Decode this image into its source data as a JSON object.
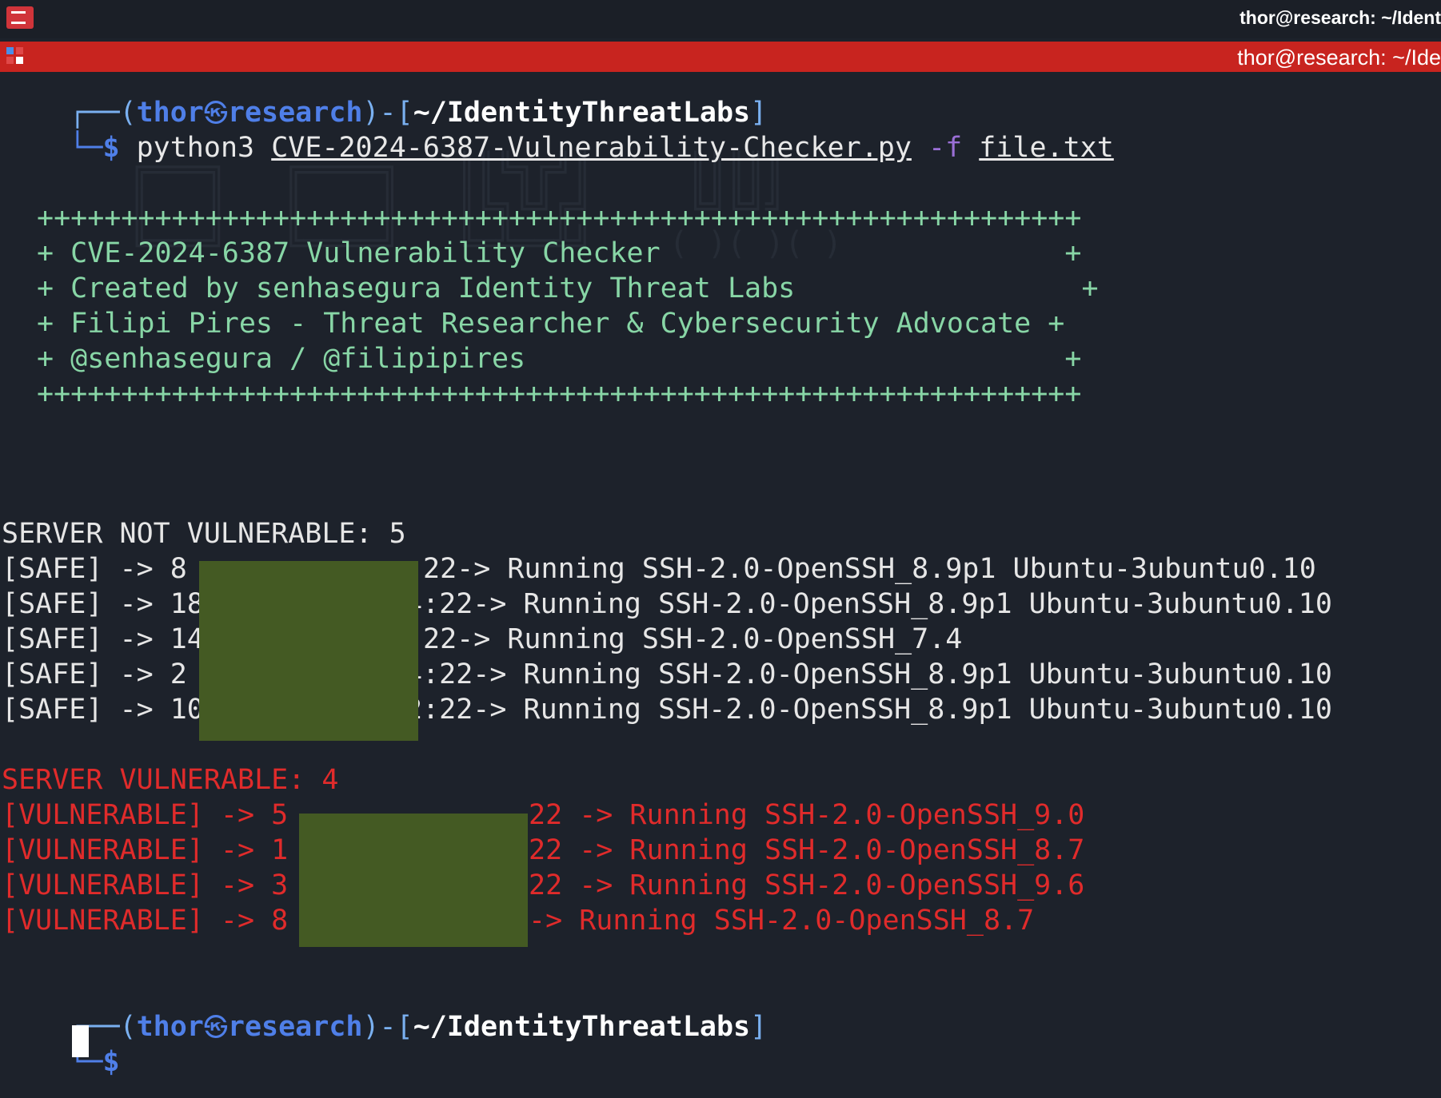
{
  "window": {
    "title": "thor@research: ~/Ident",
    "tab_title": "thor@research: ~/Ide",
    "app_icon": "terminal-icon",
    "accent_color": "#c8241f"
  },
  "prompt1": {
    "frame_open": "┌──(",
    "user": "thor",
    "at": "㉿",
    "host": "research",
    "frame_mid": ")-[",
    "path": "~/IdentityThreatLabs",
    "frame_close": "]",
    "dollar_line": "└─$ "
  },
  "command": {
    "program": "python3",
    "script": "CVE-2024-6387-Vulnerability-Checker.py",
    "flag": "-f",
    "file": "file.txt"
  },
  "banner": [
    "++++++++++++++++++++++++++++++++++++++++++++++++++++++++++++++",
    "+ CVE-2024-6387 Vulnerability Checker                        +",
    "+ Created by senhasegura Identity Threat Labs                 +",
    "+ Filipi Pires - Threat Researcher & Cybersecurity Advocate +",
    "+ @senhasegura / @filipipires                                +",
    "++++++++++++++++++++++++++++++++++++++++++++++++++++++++++++++"
  ],
  "safe": {
    "header": "SERVER NOT VULNERABLE: 5",
    "rows": [
      {
        "prefix": "[SAFE] -> 8",
        "suffix": "22-> Running SSH-2.0-OpenSSH_8.9p1 Ubuntu-3ubuntu0.10"
      },
      {
        "prefix": "[SAFE] -> 18",
        "suffix": "4:22-> Running SSH-2.0-OpenSSH_8.9p1 Ubuntu-3ubuntu0.10"
      },
      {
        "prefix": "[SAFE] -> 14",
        "suffix": "22-> Running SSH-2.0-OpenSSH_7.4"
      },
      {
        "prefix": "[SAFE] -> 2",
        "suffix": "4:22-> Running SSH-2.0-OpenSSH_8.9p1 Ubuntu-3ubuntu0.10"
      },
      {
        "prefix": "[SAFE] -> 10",
        "suffix": "2:22-> Running SSH-2.0-OpenSSH_8.9p1 Ubuntu-3ubuntu0.10"
      }
    ]
  },
  "vulnerable": {
    "header": "SERVER VULNERABLE: 4",
    "rows": [
      {
        "prefix": "[VULNERABLE] -> 5",
        "suffix": "22 -> Running SSH-2.0-OpenSSH_9.0"
      },
      {
        "prefix": "[VULNERABLE] -> 1",
        "suffix": "22 -> Running SSH-2.0-OpenSSH_8.7"
      },
      {
        "prefix": "[VULNERABLE] -> 3",
        "suffix": "22 -> Running SSH-2.0-OpenSSH_9.6"
      },
      {
        "prefix": "[VULNERABLE] -> 8",
        "suffix": "-> Running SSH-2.0-OpenSSH_8.7"
      }
    ]
  },
  "prompt2": {
    "frame_open": "┌──(",
    "user": "thor",
    "at": "㉿",
    "host": "research",
    "frame_mid": ")-[",
    "path": "~/IdentityThreatLabs",
    "frame_close": "]",
    "dollar_line": "└─$ "
  }
}
